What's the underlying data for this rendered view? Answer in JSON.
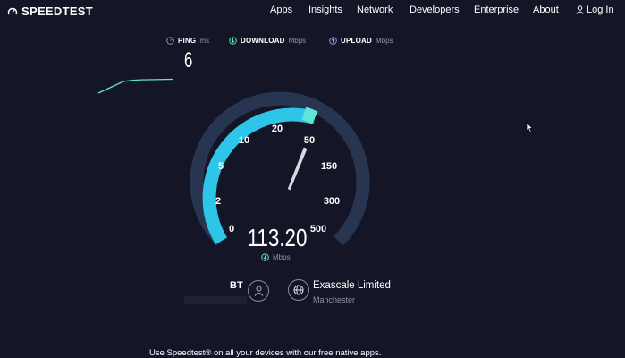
{
  "header": {
    "logo_text": "SPEEDTEST",
    "nav": [
      "Apps",
      "Insights",
      "Network",
      "Developers",
      "Enterprise",
      "About"
    ],
    "login_label": "Log In"
  },
  "metrics": {
    "ping": {
      "name": "PING",
      "unit": "ms",
      "value": "6"
    },
    "download": {
      "name": "DOWNLOAD",
      "unit": "Mbps"
    },
    "upload": {
      "name": "UPLOAD",
      "unit": "Mbps"
    }
  },
  "gauge": {
    "ticks": [
      "0",
      "2",
      "5",
      "10",
      "20",
      "50",
      "150",
      "300",
      "500"
    ],
    "current_value": "113.20",
    "unit": "Mbps"
  },
  "isp": {
    "name": "BT"
  },
  "server": {
    "name": "Exascale Limited",
    "location": "Manchester"
  },
  "footer": {
    "text": "Use Speedtest® on all your devices with our free native apps."
  },
  "colors": {
    "background": "#141526",
    "gauge_fill": "#2dc6e8",
    "gauge_track": "#283550",
    "download_icon": "#63e3b0",
    "upload_icon": "#b689f5"
  }
}
